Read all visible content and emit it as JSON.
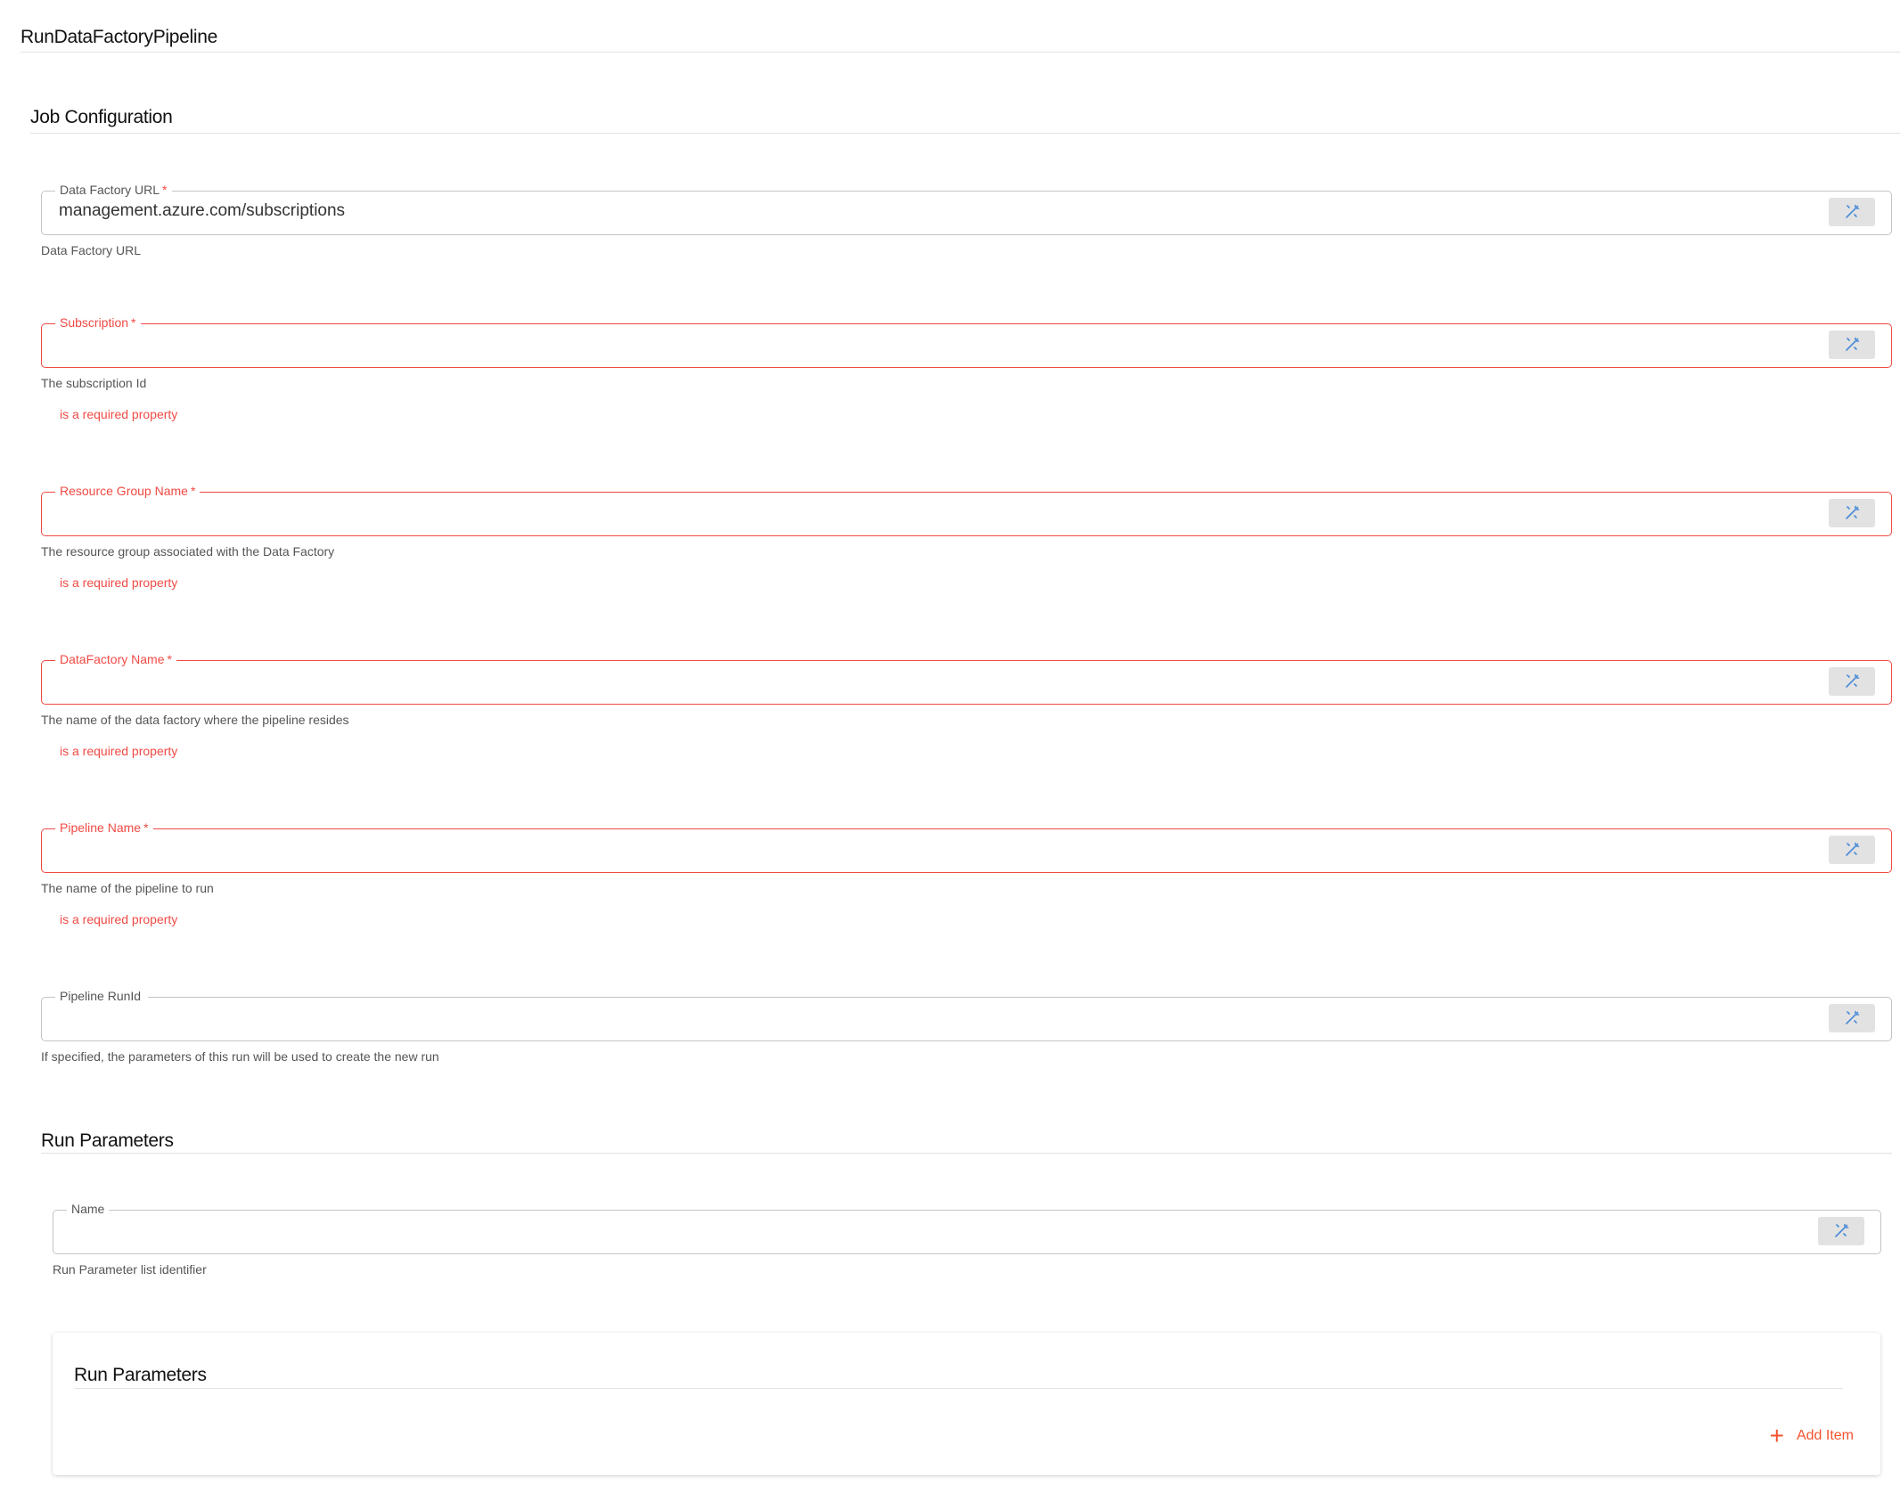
{
  "page": {
    "title": "RunDataFactoryPipeline"
  },
  "job_configuration": {
    "title": "Job Configuration",
    "fields": [
      {
        "label": "Data Factory URL",
        "required": "*",
        "value": "management.azure.com/subscriptions",
        "help": "Data Factory URL",
        "error": ""
      },
      {
        "label": "Subscription",
        "required": "*",
        "value": "",
        "help": "The subscription Id",
        "error": "is a required property"
      },
      {
        "label": "Resource Group Name",
        "required": "*",
        "value": "",
        "help": "The resource group associated with the Data Factory",
        "error": "is a required property"
      },
      {
        "label": "DataFactory Name",
        "required": "*",
        "value": "",
        "help": "The name of the data factory where the pipeline resides",
        "error": "is a required property"
      },
      {
        "label": "Pipeline Name",
        "required": "*",
        "value": "",
        "help": "The name of the pipeline to run",
        "error": "is a required property"
      },
      {
        "label": "Pipeline RunId",
        "required": "",
        "value": "",
        "help": "If specified, the parameters of this run will be used to create the new run",
        "error": ""
      }
    ]
  },
  "run_parameters": {
    "title": "Run Parameters",
    "name_field": {
      "label": "Name",
      "value": "",
      "help": "Run Parameter list identifier"
    },
    "list_card": {
      "title": "Run Parameters",
      "add_item_label": "Add Item"
    }
  },
  "colors": {
    "error": "#f04a44",
    "accent": "#f5532f",
    "icon": "#4a8ad8"
  }
}
